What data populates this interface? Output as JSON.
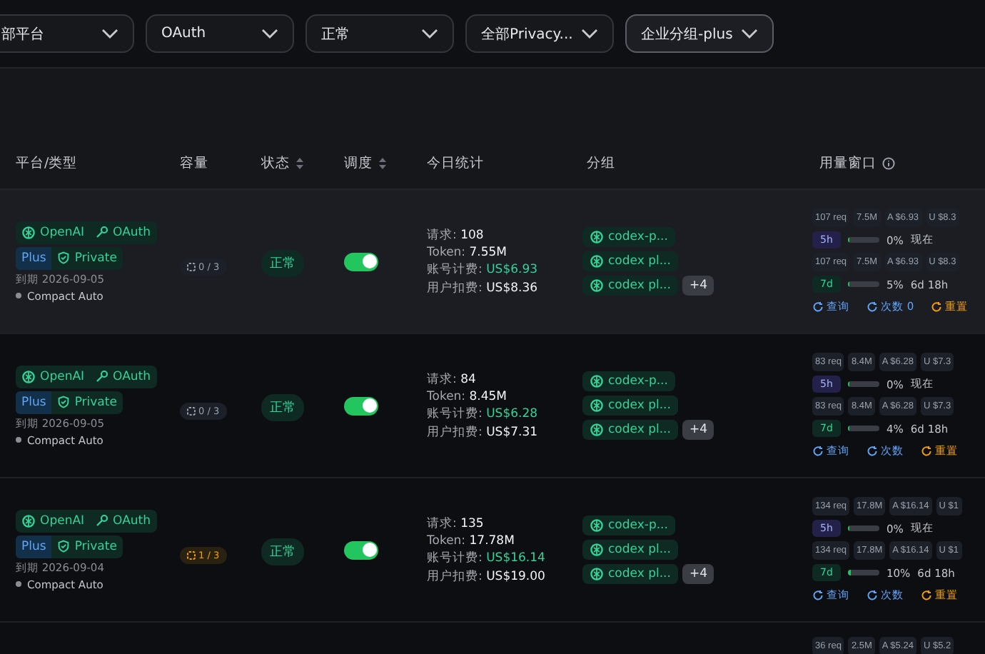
{
  "filters": [
    {
      "value": "部平台",
      "focused": false
    },
    {
      "value": "OAuth",
      "focused": false
    },
    {
      "value": "正常",
      "focused": false
    },
    {
      "value": "全部Privacy...",
      "focused": false
    },
    {
      "value": "企业分组-plus",
      "focused": true
    }
  ],
  "table": {
    "columns": [
      {
        "label": "平台/类型",
        "kind": "plain"
      },
      {
        "label": "容量",
        "kind": "plain"
      },
      {
        "label": "状态",
        "kind": "sort"
      },
      {
        "label": "调度",
        "kind": "sort"
      },
      {
        "label": "今日统计",
        "kind": "plain"
      },
      {
        "label": "分组",
        "kind": "plain"
      },
      {
        "label": "用量窗口",
        "kind": "info"
      }
    ],
    "rows": [
      {
        "highlighted": true,
        "platform": "OpenAI",
        "auth": "OAuth",
        "plan": "Plus",
        "privacy": "Private",
        "expiry": "到期 2026-09-05",
        "mode": "Compact Auto",
        "capacity": "0 / 3",
        "capacity_warn": false,
        "status": "正常",
        "schedule_on": true,
        "stats": [
          {
            "label": "请求: ",
            "value": "108",
            "kind": "plain"
          },
          {
            "label": "Token: ",
            "value": "7.55M",
            "kind": "plain"
          },
          {
            "label": "账号计费: ",
            "value": "US$6.93",
            "kind": "green"
          },
          {
            "label": "用户扣费: ",
            "value": "US$8.36",
            "kind": "plain"
          }
        ],
        "groups": [
          "codex-p...",
          "codex pl...",
          "codex pl..."
        ],
        "more": "+4",
        "usage": [
          {
            "chips": [
              "107 req",
              "7.5M",
              "A $6.93",
              "U $8.3"
            ],
            "window": "5h",
            "kind": "short",
            "level": 0,
            "percent": "0%",
            "reset": "现在"
          },
          {
            "chips": [
              "107 req",
              "7.5M",
              "A $6.93",
              "U $8.3"
            ],
            "window": "7d",
            "kind": "long",
            "level": 0.05,
            "percent": "5%",
            "reset": "6d 18h"
          }
        ],
        "actions": [
          {
            "label": "查询",
            "kind": "info"
          },
          {
            "label": "次数 0",
            "kind": "info"
          },
          {
            "label": "重置",
            "kind": "warn"
          }
        ]
      },
      {
        "highlighted": false,
        "platform": "OpenAI",
        "auth": "OAuth",
        "plan": "Plus",
        "privacy": "Private",
        "expiry": "到期 2026-09-05",
        "mode": "Compact Auto",
        "capacity": "0 / 3",
        "capacity_warn": false,
        "status": "正常",
        "schedule_on": true,
        "stats": [
          {
            "label": "请求: ",
            "value": "84",
            "kind": "plain"
          },
          {
            "label": "Token: ",
            "value": "8.45M",
            "kind": "plain"
          },
          {
            "label": "账号计费: ",
            "value": "US$6.28",
            "kind": "green"
          },
          {
            "label": "用户扣费: ",
            "value": "US$7.31",
            "kind": "plain"
          }
        ],
        "groups": [
          "codex-p...",
          "codex pl...",
          "codex pl..."
        ],
        "more": "+4",
        "usage": [
          {
            "chips": [
              "83 req",
              "8.4M",
              "A $6.28",
              "U $7.3"
            ],
            "window": "5h",
            "kind": "short",
            "level": 0,
            "percent": "0%",
            "reset": "现在"
          },
          {
            "chips": [
              "83 req",
              "8.4M",
              "A $6.28",
              "U $7.3"
            ],
            "window": "7d",
            "kind": "long",
            "level": 0.04,
            "percent": "4%",
            "reset": "6d 18h"
          }
        ],
        "actions": [
          {
            "label": "查询",
            "kind": "info"
          },
          {
            "label": "次数",
            "kind": "info"
          },
          {
            "label": "重置",
            "kind": "warn"
          }
        ]
      },
      {
        "highlighted": false,
        "platform": "OpenAI",
        "auth": "OAuth",
        "plan": "Plus",
        "privacy": "Private",
        "expiry": "到期 2026-09-04",
        "mode": "Compact Auto",
        "capacity": "1 / 3",
        "capacity_warn": true,
        "status": "正常",
        "schedule_on": true,
        "stats": [
          {
            "label": "请求: ",
            "value": "135",
            "kind": "plain"
          },
          {
            "label": "Token: ",
            "value": "17.78M",
            "kind": "plain"
          },
          {
            "label": "账号计费: ",
            "value": "US$16.14",
            "kind": "green"
          },
          {
            "label": "用户扣费: ",
            "value": "US$19.00",
            "kind": "plain"
          }
        ],
        "groups": [
          "codex-p...",
          "codex pl...",
          "codex pl..."
        ],
        "more": "+4",
        "usage": [
          {
            "chips": [
              "134 req",
              "17.8M",
              "A $16.14",
              "U $1"
            ],
            "window": "5h",
            "kind": "short",
            "level": 0,
            "percent": "0%",
            "reset": "现在"
          },
          {
            "chips": [
              "134 req",
              "17.8M",
              "A $16.14",
              "U $1"
            ],
            "window": "7d",
            "kind": "long",
            "level": 0.1,
            "percent": "10%",
            "reset": "6d 18h"
          }
        ],
        "actions": [
          {
            "label": "查询",
            "kind": "info"
          },
          {
            "label": "次数",
            "kind": "info"
          },
          {
            "label": "重置",
            "kind": "warn"
          }
        ]
      }
    ],
    "partial_row": {
      "usage_chips": [
        "36 req",
        "2.5M",
        "A $5.24",
        "U $5.2"
      ]
    }
  }
}
